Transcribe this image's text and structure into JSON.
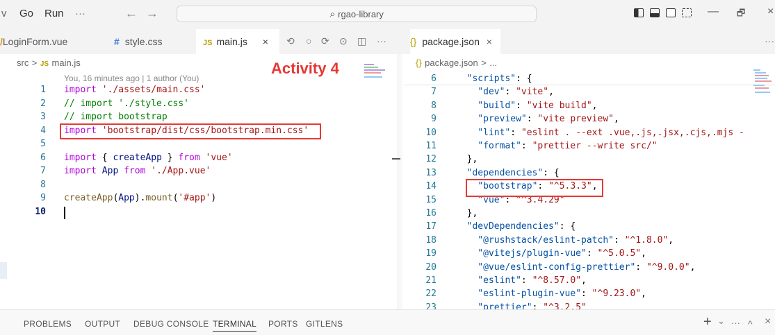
{
  "titlebar": {
    "menu": [
      "v",
      "Go",
      "Run",
      "···"
    ],
    "back": "←",
    "forward": "→",
    "search_icon": "⌕",
    "search": "rgao-library",
    "layout_icons": [
      "toggle-primary-sidebar-icon",
      "toggle-panel-icon",
      "toggle-secondary-sidebar-icon",
      "customize-layout-icon"
    ],
    "window_controls": [
      "—",
      "🗗",
      "×"
    ]
  },
  "left_group": {
    "tabs": [
      {
        "label": "LoginForm.vue",
        "prefix": "/"
      },
      {
        "label": "style.css",
        "prefix": "#"
      },
      {
        "label": "main.js",
        "prefix": "JS",
        "close": "×"
      }
    ],
    "toolbar": [
      "⟲",
      "○",
      "⟳",
      "⊙",
      "◫",
      "···"
    ],
    "breadcrumb": {
      "folder": "src",
      "sep": ">",
      "file_badge": "JS",
      "file": "main.js"
    },
    "blame": "You, 16 minutes ago | 1 author (You)",
    "annotation": "Activity 4",
    "line_numbers": [
      "1",
      "2",
      "3",
      "4",
      "5",
      "6",
      "7",
      "8",
      "9",
      "10"
    ],
    "lines": [
      [
        [
          "kw",
          "import "
        ],
        [
          "str",
          "'./assets/main.css'"
        ]
      ],
      [
        [
          "cm",
          "// import './style.css'"
        ]
      ],
      [
        [
          "cm",
          "// import bootstrap"
        ]
      ],
      [
        [
          "kw",
          "import "
        ],
        [
          "str",
          "'bootstrap/dist/css/bootstrap.min.css'"
        ]
      ],
      [],
      [
        [
          "kw",
          "import "
        ],
        [
          "pun",
          "{ "
        ],
        [
          "var",
          "createApp"
        ],
        [
          "pun",
          " } "
        ],
        [
          "kw",
          "from "
        ],
        [
          "str",
          "'vue'"
        ]
      ],
      [
        [
          "kw",
          "import "
        ],
        [
          "var",
          "App "
        ],
        [
          "kw",
          "from "
        ],
        [
          "str",
          "'./App.vue'"
        ]
      ],
      [],
      [
        [
          "fn",
          "createApp"
        ],
        [
          "pun",
          "("
        ],
        [
          "var",
          "App"
        ],
        [
          "pun",
          ")."
        ],
        [
          "fn",
          "mount"
        ],
        [
          "pun",
          "("
        ],
        [
          "str",
          "'#app'"
        ],
        [
          "pun",
          ")"
        ]
      ],
      []
    ]
  },
  "right_group": {
    "tab": {
      "label": "package.json",
      "prefix": "{}",
      "close": "×"
    },
    "more": "···",
    "breadcrumb": {
      "badge": "{}",
      "file": "package.json",
      "sep": ">",
      "rest": "..."
    },
    "line_numbers": [
      "6",
      "7",
      "8",
      "9",
      "10",
      "11",
      "12",
      "13",
      "14",
      "15",
      "16",
      "17",
      "18",
      "19",
      "20",
      "21",
      "22",
      "23"
    ],
    "lines": [
      [
        [
          "key",
          "  \"scripts\""
        ],
        [
          "pun",
          ": {"
        ]
      ],
      [
        [
          "key",
          "    \"dev\""
        ],
        [
          "pun",
          ": "
        ],
        [
          "str",
          "\"vite\""
        ],
        [
          "pun",
          ","
        ]
      ],
      [
        [
          "key",
          "    \"build\""
        ],
        [
          "pun",
          ": "
        ],
        [
          "str",
          "\"vite build\""
        ],
        [
          "pun",
          ","
        ]
      ],
      [
        [
          "key",
          "    \"preview\""
        ],
        [
          "pun",
          ": "
        ],
        [
          "str",
          "\"vite preview\""
        ],
        [
          "pun",
          ","
        ]
      ],
      [
        [
          "key",
          "    \"lint\""
        ],
        [
          "pun",
          ": "
        ],
        [
          "str",
          "\"eslint . --ext .vue,.js,.jsx,.cjs,.mjs -"
        ]
      ],
      [
        [
          "key",
          "    \"format\""
        ],
        [
          "pun",
          ": "
        ],
        [
          "str",
          "\"prettier --write src/\""
        ]
      ],
      [
        [
          "pun",
          "  },"
        ]
      ],
      [
        [
          "key",
          "  \"dependencies\""
        ],
        [
          "pun",
          ": {"
        ]
      ],
      [
        [
          "key",
          "    \"bootstrap\""
        ],
        [
          "pun",
          ": "
        ],
        [
          "str",
          "\"^5.3.3\""
        ],
        [
          "pun",
          ","
        ]
      ],
      [
        [
          "key",
          "    \"vue\""
        ],
        [
          "pun",
          ": "
        ],
        [
          "str",
          "\"^3.4.29\""
        ]
      ],
      [
        [
          "pun",
          "  },"
        ]
      ],
      [
        [
          "key",
          "  \"devDependencies\""
        ],
        [
          "pun",
          ": {"
        ]
      ],
      [
        [
          "key",
          "    \"@rushstack/eslint-patch\""
        ],
        [
          "pun",
          ": "
        ],
        [
          "str",
          "\"^1.8.0\""
        ],
        [
          "pun",
          ","
        ]
      ],
      [
        [
          "key",
          "    \"@vitejs/plugin-vue\""
        ],
        [
          "pun",
          ": "
        ],
        [
          "str",
          "\"^5.0.5\""
        ],
        [
          "pun",
          ","
        ]
      ],
      [
        [
          "key",
          "    \"@vue/eslint-config-prettier\""
        ],
        [
          "pun",
          ": "
        ],
        [
          "str",
          "\"^9.0.0\""
        ],
        [
          "pun",
          ","
        ]
      ],
      [
        [
          "key",
          "    \"eslint\""
        ],
        [
          "pun",
          ": "
        ],
        [
          "str",
          "\"^8.57.0\""
        ],
        [
          "pun",
          ","
        ]
      ],
      [
        [
          "key",
          "    \"eslint-plugin-vue\""
        ],
        [
          "pun",
          ": "
        ],
        [
          "str",
          "\"^9.23.0\""
        ],
        [
          "pun",
          ","
        ]
      ],
      [
        [
          "key",
          "    \"prettier\""
        ],
        [
          "pun",
          ": "
        ],
        [
          "str",
          "\"^3.2.5\""
        ]
      ]
    ]
  },
  "panel": {
    "tabs": [
      "PROBLEMS",
      "OUTPUT",
      "DEBUG CONSOLE",
      "TERMINAL",
      "PORTS",
      "GITLENS"
    ],
    "active": "TERMINAL",
    "actions": [
      "+",
      "⌄",
      "···",
      "^",
      "×"
    ]
  },
  "colors": {
    "annotation_red": "#e53935",
    "line_number": "#237893"
  }
}
